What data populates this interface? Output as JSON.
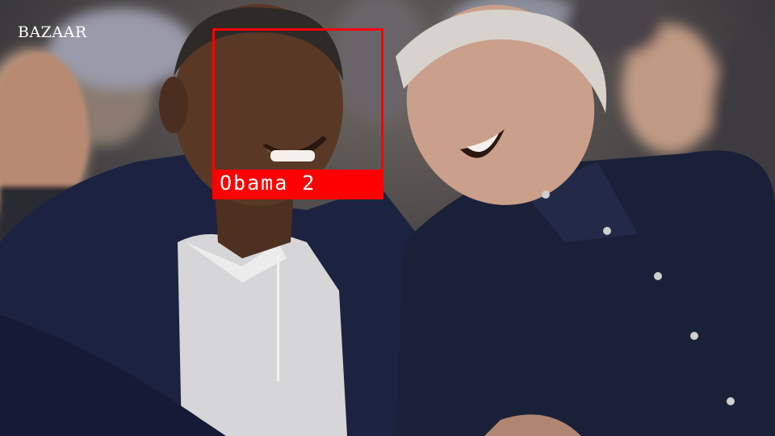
{
  "watermark": {
    "text": "BAZAAR"
  },
  "detection": {
    "label": "Obama 2",
    "color": "#ff0000"
  },
  "palette": {
    "jacket_navy": "#1c2340",
    "shirt_dark": "#1a2038",
    "polo_white": "#d9d9d9",
    "skin_dark": "#5a3826",
    "skin_light": "#caa08a",
    "hair_grey": "#d8d2cc",
    "crowd_blur": "#5b5450"
  }
}
